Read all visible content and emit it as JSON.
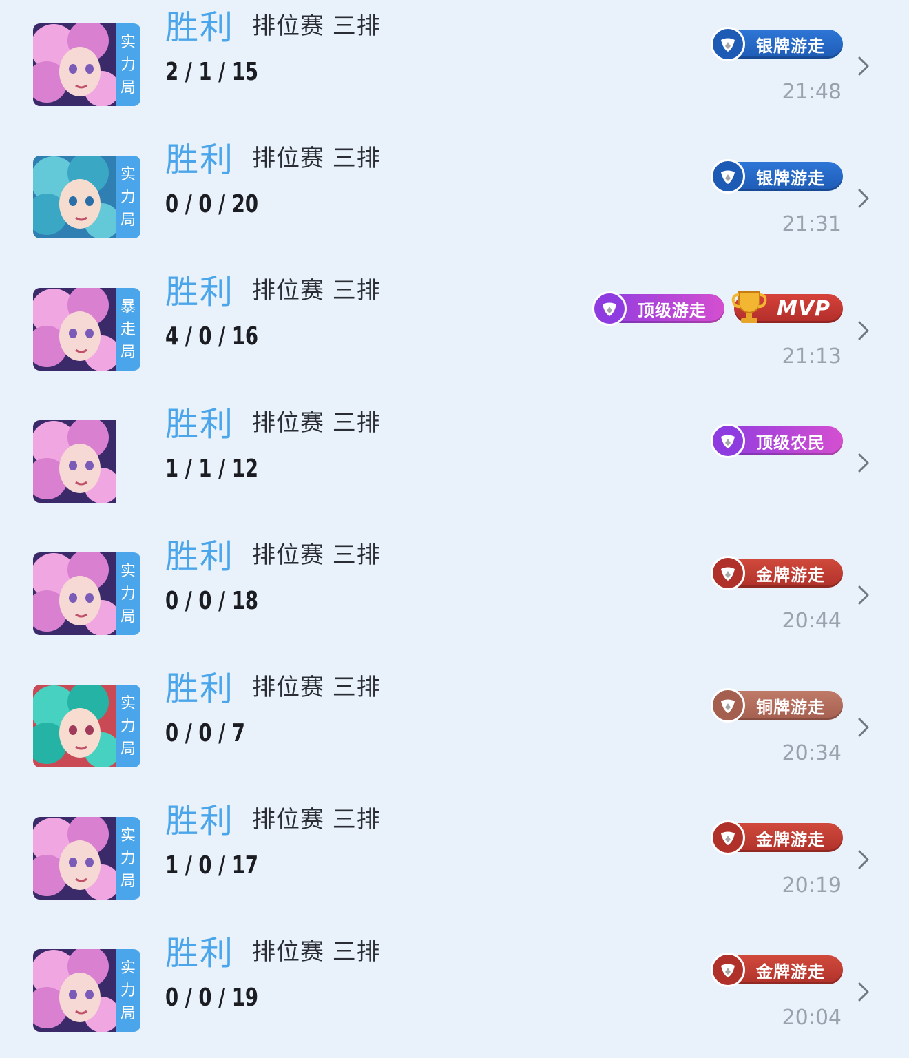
{
  "colors": {
    "background": "#e9f2fb",
    "accent": "#4aa5ea",
    "time_gray": "#9aa3ad",
    "silver_badge": "#1e5bb5",
    "gold_badge": "#b0312a",
    "bronze_badge": "#a45f4f",
    "top_badge": "#8e3be0"
  },
  "matches": [
    {
      "hero": "pink-hair-hero",
      "tag": [
        "实",
        "力",
        "局"
      ],
      "result": "胜利",
      "mode": "排位赛 三排",
      "kda": "2 / 1 / 15",
      "badges": [
        {
          "type": "silver",
          "label": "银牌游走"
        }
      ],
      "time": "21:48"
    },
    {
      "hero": "teal-hair-hero",
      "tag": [
        "实",
        "力",
        "局"
      ],
      "result": "胜利",
      "mode": "排位赛 三排",
      "kda": "0 / 0 / 20",
      "badges": [
        {
          "type": "silver",
          "label": "银牌游走"
        }
      ],
      "time": "21:31"
    },
    {
      "hero": "pink-hair-hero",
      "tag": [
        "暴",
        "走",
        "局"
      ],
      "result": "胜利",
      "mode": "排位赛 三排",
      "kda": "4 / 0 / 16",
      "badges": [
        {
          "type": "top",
          "label": "顶级游走"
        },
        {
          "type": "mvp",
          "label": "MVP"
        }
      ],
      "time": "21:13"
    },
    {
      "hero": "pink-hair-hero",
      "tag": [],
      "result": "胜利",
      "mode": "排位赛 三排",
      "kda": "1 / 1 / 12",
      "badges": [
        {
          "type": "top",
          "label": "顶级农民"
        }
      ],
      "time": ""
    },
    {
      "hero": "pink-hair-hero",
      "tag": [
        "实",
        "力",
        "局"
      ],
      "result": "胜利",
      "mode": "排位赛 三排",
      "kda": "0 / 0 / 18",
      "badges": [
        {
          "type": "gold",
          "label": "金牌游走"
        }
      ],
      "time": "20:44"
    },
    {
      "hero": "green-hair-hero",
      "tag": [
        "实",
        "力",
        "局"
      ],
      "result": "胜利",
      "mode": "排位赛 三排",
      "kda": "0 / 0 / 7",
      "badges": [
        {
          "type": "bronze",
          "label": "铜牌游走"
        }
      ],
      "time": "20:34"
    },
    {
      "hero": "pink-hair-hero",
      "tag": [
        "实",
        "力",
        "局"
      ],
      "result": "胜利",
      "mode": "排位赛 三排",
      "kda": "1 / 0 / 17",
      "badges": [
        {
          "type": "gold",
          "label": "金牌游走"
        }
      ],
      "time": "20:19"
    },
    {
      "hero": "pink-hair-hero",
      "tag": [
        "实",
        "力",
        "局"
      ],
      "result": "胜利",
      "mode": "排位赛 三排",
      "kda": "0 / 0 / 19",
      "badges": [
        {
          "type": "gold",
          "label": "金牌游走"
        }
      ],
      "time": "20:04"
    }
  ]
}
